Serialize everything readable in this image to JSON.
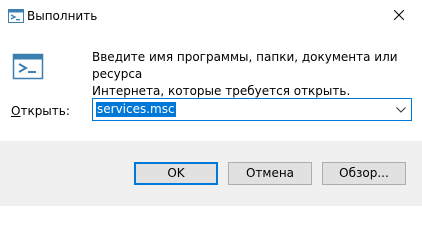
{
  "window": {
    "title": "Выполнить",
    "icon": "run-icon",
    "close_icon": "close-icon"
  },
  "body": {
    "description_line1": "Введите имя программы, папки, документа или ресурса",
    "description_line2": "Интернета, которые требуется открыть.",
    "open_label_prefix": "О",
    "open_label_rest": "ткрыть:",
    "combo_value": "services.msc",
    "combo_arrow_icon": "chevron-down-icon"
  },
  "buttons": {
    "ok": "OK",
    "cancel": "Отмена",
    "browse": "Обзор..."
  },
  "colors": {
    "accent": "#0078d7",
    "footer_bg": "#f0f0f0",
    "button_bg": "#e1e1e1"
  }
}
